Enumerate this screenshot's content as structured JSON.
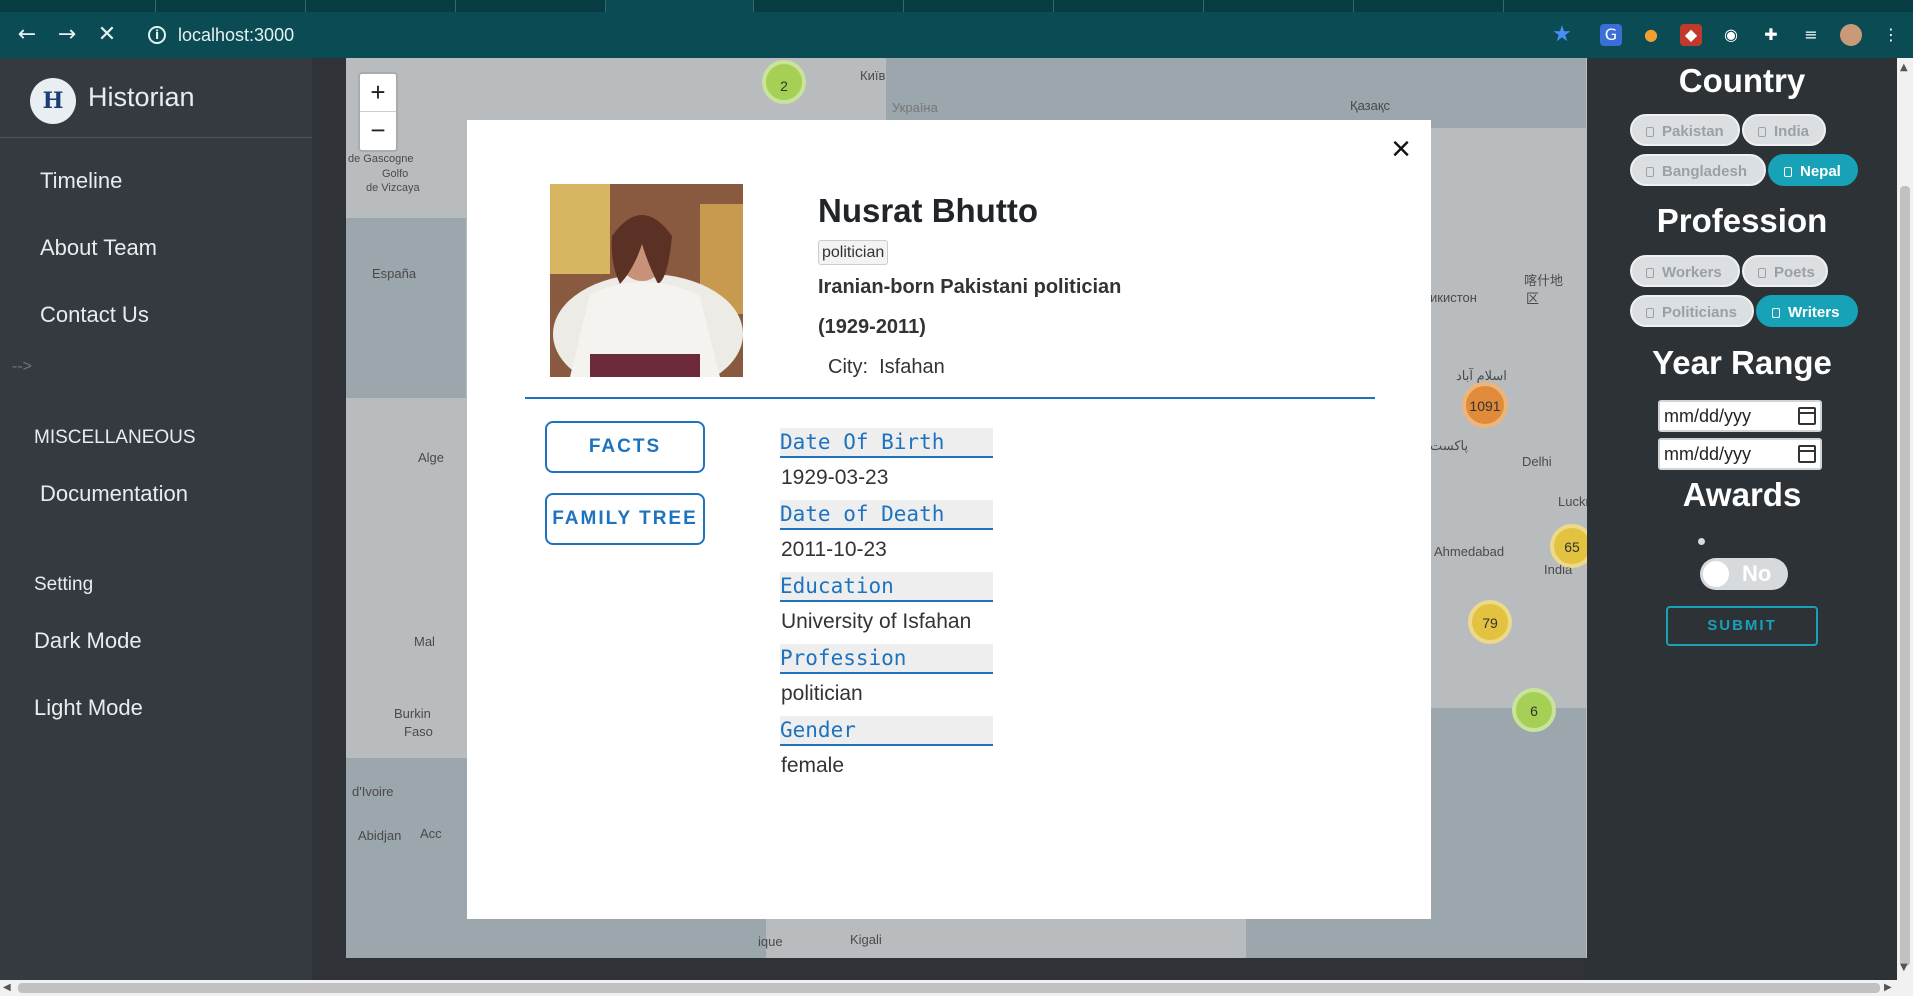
{
  "browser": {
    "url": "localhost:3000"
  },
  "sidebar": {
    "brand": "Historian",
    "logo_letter": "H",
    "nav": [
      {
        "label": "Timeline"
      },
      {
        "label": "About Team"
      },
      {
        "label": "Contact Us"
      }
    ],
    "comment_text": "-->",
    "misc_heading": "MISCELLANEOUS",
    "documentation": "Documentation",
    "setting_heading": "Setting",
    "dark_mode": "Dark Mode",
    "light_mode": "Light Mode"
  },
  "map": {
    "zoom_in": "+",
    "zoom_out": "−",
    "labels": [
      "Київ",
      "Україна",
      "Қазақс",
      "España",
      "de Gascogne",
      "Golfo",
      "de Vizcaya",
      "Alge",
      "Mal",
      "Burkin",
      "Faso",
      "d'Ivoire",
      "Abidjan",
      "Acc",
      "Kigali",
      "Delhi",
      "Lucknow",
      "Ahmedabad",
      "India",
      "喀什地",
      "区",
      "икистон",
      "اسلام آباد",
      "پاکست",
      "ique"
    ],
    "clusters": [
      {
        "value": "2",
        "color": "#8fbf3f"
      },
      {
        "value": "1091",
        "color": "#e07b2a"
      },
      {
        "value": "65",
        "color": "#e0c032"
      },
      {
        "value": "79",
        "color": "#e0c032"
      },
      {
        "value": "6",
        "color": "#8fbf3f"
      }
    ]
  },
  "filters": {
    "country_title": "Country",
    "countries": [
      {
        "label": "Pakistan",
        "checked": false
      },
      {
        "label": "India",
        "checked": false
      },
      {
        "label": "Bangladesh",
        "checked": false
      },
      {
        "label": "Nepal",
        "checked": true
      }
    ],
    "profession_title": "Profession",
    "professions": [
      {
        "label": "Workers",
        "checked": false
      },
      {
        "label": "Poets",
        "checked": false
      },
      {
        "label": "Politicians",
        "checked": false
      },
      {
        "label": "Writers",
        "checked": true
      }
    ],
    "year_range_title": "Year Range",
    "date_from_placeholder": "mm/dd/yyy",
    "date_to_placeholder": "mm/dd/yyy",
    "awards_title": "Awards",
    "awards_toggle_label": "No",
    "submit_label": "SUBMIT"
  },
  "modal": {
    "close": "×",
    "name": "Nusrat Bhutto",
    "tag": "politician",
    "description": "Iranian-born Pakistani politician",
    "years": "(1929-2011)",
    "city_label": "City:",
    "city": "Isfahan",
    "buttons": {
      "facts": "FACTS",
      "family_tree": "FAMILY TREE"
    },
    "fields": [
      {
        "label": "Date Of Birth",
        "value": "1929-03-23"
      },
      {
        "label": "Date of Death",
        "value": "2011-10-23"
      },
      {
        "label": "Education",
        "value": "University of Isfahan"
      },
      {
        "label": "Profession",
        "value": "politician"
      },
      {
        "label": "Gender",
        "value": "female"
      }
    ]
  },
  "colors": {
    "accent": "#17a2b8",
    "modal_accent": "#1e73be",
    "sidebar_bg": "#343a40",
    "chrome_bg": "#0b4b53"
  }
}
